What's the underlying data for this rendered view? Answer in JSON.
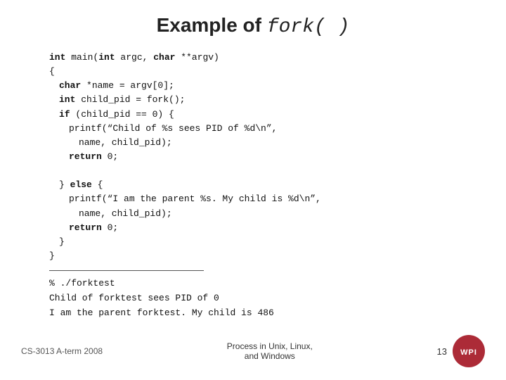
{
  "title": {
    "text_before": "Example of ",
    "code": "fork( )"
  },
  "code": {
    "lines": [
      {
        "indent": 0,
        "text": "int main(int argc, char **argv)"
      },
      {
        "indent": 0,
        "text": "{"
      },
      {
        "indent": 1,
        "text": "char *name = argv[0];"
      },
      {
        "indent": 1,
        "text": "int child_pid = fork();"
      },
      {
        "indent": 1,
        "text": "if (child_pid == 0) {"
      },
      {
        "indent": 2,
        "text": "printf(“Child of %s sees PID of %d\\n\","
      },
      {
        "indent": 3,
        "text": "name, child_pid);"
      },
      {
        "indent": 2,
        "text": "return 0;"
      },
      {
        "indent": 0,
        "text": ""
      },
      {
        "indent": 1,
        "text": "} else {"
      },
      {
        "indent": 2,
        "text": "printf(“I am the parent %s. My child is %d\\n\","
      },
      {
        "indent": 3,
        "text": "name, child_pid);"
      },
      {
        "indent": 2,
        "text": "return 0;"
      },
      {
        "indent": 1,
        "text": "}"
      },
      {
        "indent": 0,
        "text": "}"
      }
    ]
  },
  "output": {
    "lines": [
      "% ./forktest",
      "Child of forktest sees PID of 0",
      "I am the parent forktest. My child is 486"
    ]
  },
  "footer": {
    "left": "CS-3013 A-term 2008",
    "center_line1": "Process in Unix, Linux,",
    "center_line2": "and Windows",
    "page": "13",
    "logo": "WPI"
  }
}
